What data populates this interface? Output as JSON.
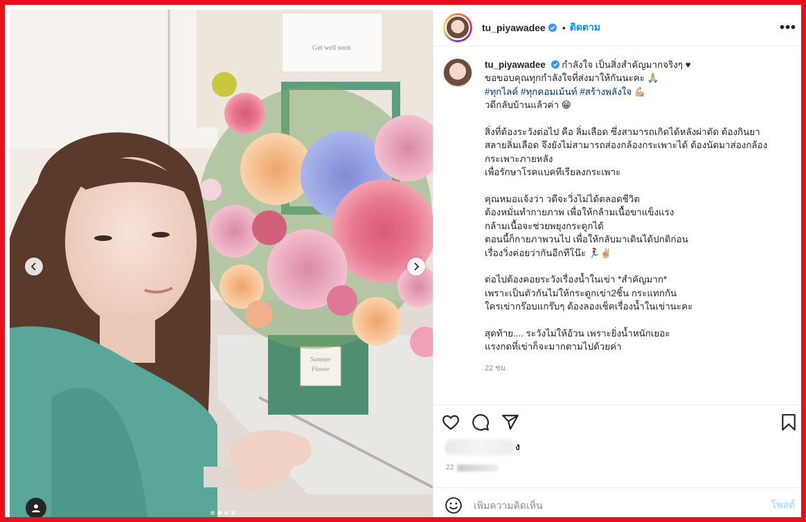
{
  "post": {
    "username": "tu_piyawadee",
    "follow_label": "ติดตาม",
    "separator": "•",
    "more_label": "•••",
    "colors": {
      "accent": "#0095f6",
      "hashtag": "#00376b",
      "frame": "#e8101c",
      "muted": "#8e8e8e"
    },
    "icons": [
      "verified-badge-icon",
      "more-options-icon",
      "heart-icon",
      "comment-icon",
      "share-icon",
      "bookmark-icon",
      "emoji-icon",
      "chevron-left-icon",
      "chevron-right-icon",
      "user-tag-icon"
    ]
  },
  "media": {
    "card_text": "Get well soon",
    "box_label_1": "Summer",
    "box_label_2": "Flower",
    "carousel": {
      "slides": 4,
      "active": 2
    }
  },
  "caption": {
    "username": "tu_piyawadee",
    "lines": {
      "l1": "กำลังใจ เป็นสิ่งสำคัญมากจริงๆ ♥",
      "l2": "ขอขอบคุณทุกกำลังใจที่ส่งมาให้กันนะคะ 🙏🏼",
      "l3a": "#ทุกไลค์",
      "l3b": "#ทุกคอมเม้นท์",
      "l3c": "#สร้างพลังใจ",
      "l3d": "💪🏼",
      "l4": "วดีกลับบ้านแล้วค่า 😁",
      "l5": "สิ่งที่ต้องระวังต่อไป คือ ลิ่มเลือด ซึ่งสามารถเกิดได้หลังผ่าตัด ต้องกินยา",
      "l6": "สลายลิ่มเลือด จึงยังไม่สามารถส่องกล้องกระเพาะได้ ต้องนัดมาส่องกล้อง",
      "l7": "กระเพาะภายหลัง",
      "l8": "เพื่อรักษาโรคแบคทีเรียลงกระเพาะ",
      "l9": "คุณหมอแจ้งว่า วดีจะวิ่งไม่ได้ตลอดชีวิต",
      "l10": "ต้องหมั่นทำกายภาพ เพื่อให้กล้ามเนื้อขาแข็งแรง",
      "l11": "กล้ามเนื้อจะช่วยพยุงกระดูกได้",
      "l12": "ตอนนี้ก็กายภาพวนไป เพื่อให้กลับมาเดินได้ปกติก่อน",
      "l13": "เรื่องวิ่งค่อยว่ากันอีกทีโน๊ะ 🏃‍♀️✌🏼",
      "l14": "ต่อไปต้องคอยระวังเรื่องน้ำในเข่า *สำคัญมาก*",
      "l15": "เพราะเป็นตัวกันไม่ให้กระดูกเข่า2ชิ้น กระแทกกัน",
      "l16": "ใครเข่ากร๊อบแกร๊บๆ ต้องลองเช็คเรื่องน้ำในเข่านะคะ",
      "l17": "สุดท้าย.... ระวังไม่ให้อ้วน เพราะยิ่งน้ำหนักเยอะ",
      "l18": "แรงกดที่เข่าก็จะมากตามไปด้วยค่า"
    },
    "timestamp": "22 ชม."
  },
  "engagement": {
    "likes_suffix": "ง",
    "date_prefix": "22"
  },
  "comment_box": {
    "placeholder": "เพิ่มความคิดเห็น",
    "post_label": "โพสต์"
  }
}
